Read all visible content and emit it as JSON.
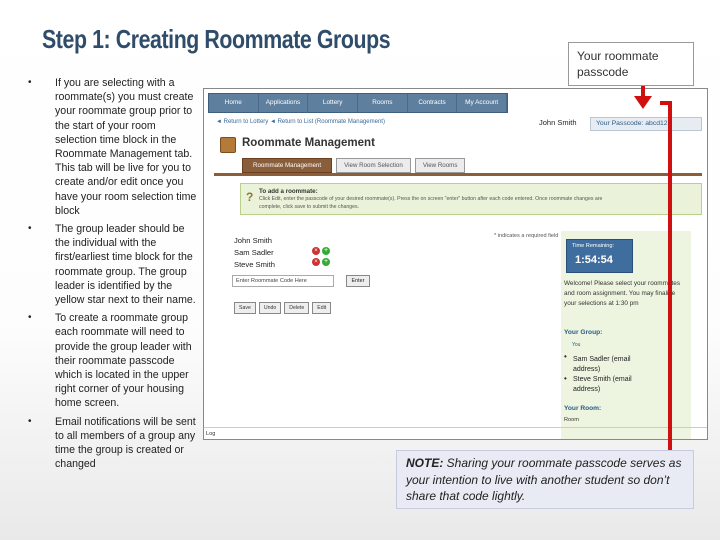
{
  "slide": {
    "title": "Step 1: Creating Roommate Groups",
    "bullets": [
      "If you are selecting with a roommate(s) you must create your roommate group prior to the start of your room selection time block in the Roommate Management tab. This tab will be live for you to create and/or edit once you have your room selection time block",
      "The group leader should be the individual with the first/earliest time block for the roommate group. The group leader is identified by the yellow star next to their name.",
      "To create a roommate group each roommate will need to provide the group leader with their roommate passcode which is located in the upper right corner of your housing home screen.",
      "Email notifications will be sent to all members of a group any time the group is created or changed"
    ],
    "callout_top": "Your roommate passcode",
    "note_label": "NOTE:",
    "note_text": " Sharing your roommate passcode serves as your intention to live with another student so don’t share that code lightly."
  },
  "colors": {
    "title": "#2f4d6b",
    "arrow": "#d01010",
    "nav": "#5f7f9f",
    "accent_brown": "#8a5e3a",
    "timer_bg": "#3f6e9e",
    "note_bg": "#e8eaf4"
  },
  "screenshot": {
    "nav_tabs": [
      "Home",
      "Applications",
      "Lottery",
      "Rooms",
      "Contracts",
      "My Account"
    ],
    "breadcrumbs": "◄ Return to Lottery  ◄ Return to List (Roommate Management)",
    "user_name": "John Smith",
    "passcode_label": "Your Passcode: abcd123",
    "page_title": "Roommate Management",
    "tabs": [
      "Roommate Management",
      "View Room Selection",
      "View Rooms"
    ],
    "info_title": "To add a roommate:",
    "info_line1": "Click Edit, enter the passcode of your desired roommate(s). Press the on screen \"enter\" button after each code entered. Once roommate changes are",
    "info_line2": "complete, click save to submit the changes.",
    "required_note": "* indicates a required field",
    "group_names": [
      "John Smith",
      "Sam Sadler",
      "Steve Smith"
    ],
    "code_placeholder": "Enter Roommate Code Here",
    "enter_label": "Enter",
    "action_buttons": [
      "Save",
      "Undo",
      "Delete",
      "Edit"
    ],
    "time_label": "Time Remaining:",
    "time_value": "1:54:54",
    "welcome_text": "Welcome! Please select your roommates and room assignment. You may finalize your selections at 1:30 pm",
    "your_group": "Your Group:",
    "group_you": "You",
    "members": [
      "Sam Sadler (email address)",
      "Steve Smith (email address)"
    ],
    "your_room": "Your Room:",
    "room_label": "Room",
    "log_label": "Log"
  }
}
